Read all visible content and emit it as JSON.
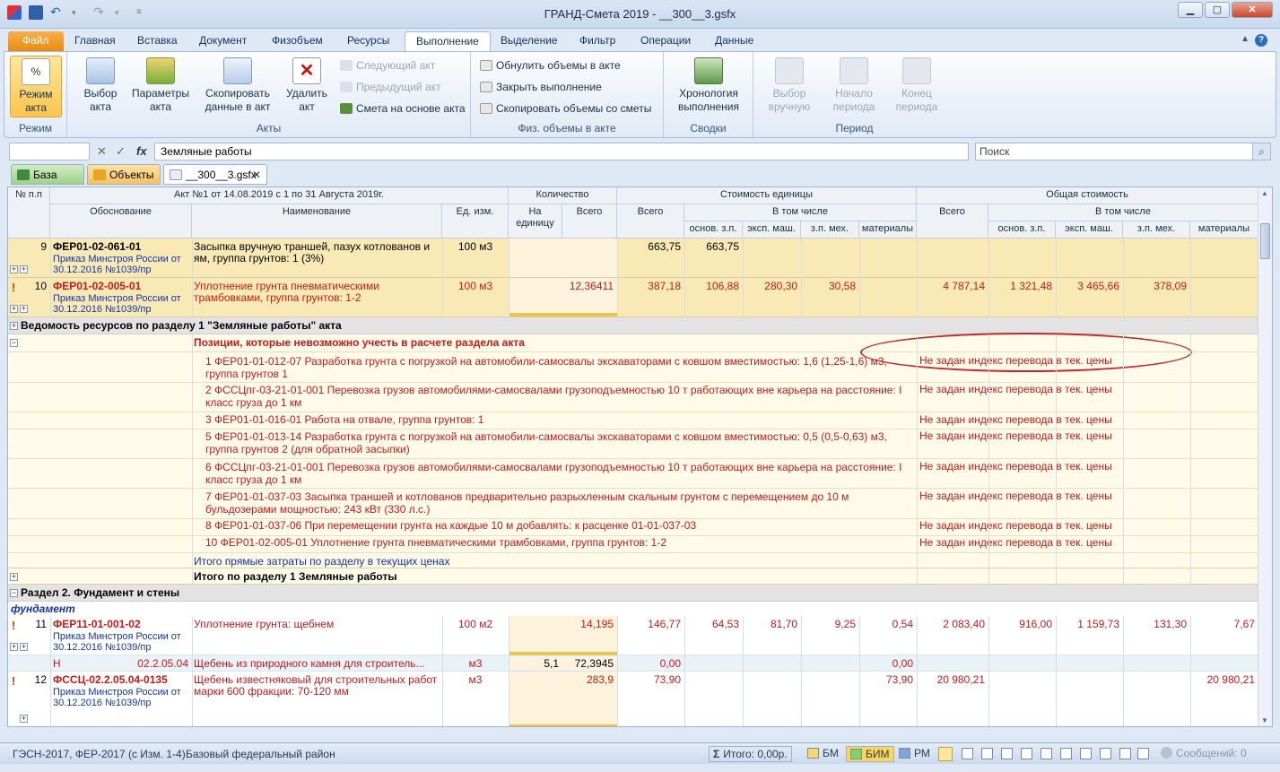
{
  "window": {
    "title": "ГРАНД-Смета 2019 - __300__3.gsfx"
  },
  "tabs": [
    "Файл",
    "Главная",
    "Вставка",
    "Документ",
    "Физобъем",
    "Ресурсы",
    "Выполнение",
    "Выделение",
    "Фильтр",
    "Операции",
    "Данные"
  ],
  "ribbon": {
    "mode_btn": "Режим акта",
    "mode_group": "Режим",
    "select_act": "Выбор акта",
    "act_params": "Параметры акта",
    "copy_data": "Скопировать данные в акт",
    "delete_act": "Удалить акт",
    "next_act": "Следующий акт",
    "prev_act": "Предыдущий акт",
    "estimate_based": "Смета на основе акта",
    "acts_group": "Акты",
    "reset_volumes": "Обнулить объемы в акте",
    "close_exec": "Закрыть выполнение",
    "copy_volumes": "Скопировать объемы со сметы",
    "phys_group": "Физ. объемы в акте",
    "chronology": "Хронология выполнения",
    "summaries_group": "Сводки",
    "manual_select": "Выбор вручную",
    "period_start": "Начало периода",
    "period_end": "Конец периода",
    "period_group": "Период"
  },
  "formula": {
    "value": "Земляные работы",
    "fx": "fx"
  },
  "search": {
    "placeholder": "Поиск"
  },
  "doctabs": {
    "base": "База",
    "objects": "Объекты",
    "file": "__300__3.gsfx"
  },
  "header": {
    "num": "№ п.п",
    "act_title": "Акт №1 от 14.08.2019 с 1 по 31 Августа 2019г.",
    "basis": "Обоснование",
    "name": "Наименование",
    "unit": "Ед. изм.",
    "qty": "Количество",
    "per_unit": "На единицу",
    "total": "Всего",
    "unit_cost": "Стоимость единицы",
    "uc_total": "Всего",
    "incl": "В том числе",
    "osn_zp": "основ. з.п.",
    "eksp_mash": "эксп. маш.",
    "zp_meh": "з.п. мех.",
    "materials": "материалы",
    "total_cost": "Общая стоимость",
    "tc_total": "Всего",
    "incl2": "В том числе",
    "osn_zp2": "основ. з.п.",
    "eksp_mash2": "эксп. маш.",
    "zp_meh2": "з.п. мех.",
    "materials2": "материалы"
  },
  "rows": {
    "r9": {
      "num": "9",
      "code": "ФЕР01-02-061-01",
      "order": "Приказ Минстроя России от 30.12.2016 №1039/пр",
      "name": "Засыпка вручную траншей, пазух котлованов и ям, группа грунтов: 1 (3%)",
      "unit": "100 м3",
      "uc_total": "663,75",
      "osn_zp": "663,75"
    },
    "r10": {
      "num": "10",
      "code": "ФЕР01-02-005-01",
      "order": "Приказ Минстроя России от 30.12.2016 №1039/пр",
      "name": "Уплотнение грунта пневматическими трамбовками, группа грунтов: 1-2",
      "unit": "100 м3",
      "qty_total": "12,36411",
      "uc_total": "387,18",
      "osn_zp": "106,88",
      "eksp": "280,30",
      "zpmeh": "30,58",
      "tc_total": "4 787,14",
      "tc_osn": "1 321,48",
      "tc_eksp": "3 465,66",
      "tc_zpmeh": "378,09"
    },
    "section_res": "Ведомость ресурсов по разделу 1 \"Земляные работы\" акта",
    "positions_title": "Позиции, которые невозможно учесть в расчете раздела акта",
    "positions": [
      {
        "text": "1 ФЕР01-01-012-07 Разработка грунта с погрузкой на автомобили-самосвалы экскаваторами с ковшом вместимостью: 1,6 (1,25-1,6) м3, группа грунтов 1",
        "note": "Не задан индекс перевода в тек. цены"
      },
      {
        "text": "2 ФССЦпг-03-21-01-001 Перевозка грузов автомобилями-самосвалами грузоподъемностью 10 т работающих вне карьера на расстояние: I класс груза до 1 км",
        "note": "Не задан индекс перевода в тек. цены"
      },
      {
        "text": "3 ФЕР01-01-016-01 Работа на отвале, группа грунтов: 1",
        "note": "Не задан индекс перевода в тек. цены"
      },
      {
        "text": "5 ФЕР01-01-013-14 Разработка грунта с погрузкой на автомобили-самосвалы экскаваторами с ковшом вместимостью: 0,5 (0,5-0,63) м3, группа грунтов 2 (для обратной засыпки)",
        "note": "Не задан индекс перевода в тек. цены"
      },
      {
        "text": "6 ФССЦпг-03-21-01-001 Перевозка грузов автомобилями-самосвалами грузоподъемностью 10 т работающих вне карьера на расстояние: I класс груза до 1 км",
        "note": "Не задан индекс перевода в тек. цены"
      },
      {
        "text": "7 ФЕР01-01-037-03 Засыпка траншей и котлованов предварительно разрыхленным скальным грунтом с перемещением до 10 м бульдозерами мощностью: 243 кВт (330 л.с.)",
        "note": "Не задан индекс перевода в тек. цены"
      },
      {
        "text": "8 ФЕР01-01-037-06 При перемещении грунта на каждые 10 м добавлять: к расценке 01-01-037-03",
        "note": "Не задан индекс перевода в тек. цены"
      },
      {
        "text": "10 ФЕР01-02-005-01 Уплотнение грунта пневматическими трамбовками, группа грунтов: 1-2",
        "note": "Не задан индекс перевода в тек. цены"
      }
    ],
    "direct_costs": "Итого прямые затраты по разделу в текущих ценах",
    "total_section1": "Итого по разделу 1 Земляные работы",
    "section2": "Раздел 2. Фундамент и стены",
    "subsection": "фундамент",
    "r11": {
      "num": "11",
      "code": "ФЕР11-01-001-02",
      "order": "Приказ Минстроя России от 30.12.2016 №1039/пр",
      "name": "Уплотнение грунта: щебнем",
      "unit": "100 м2",
      "qty_total": "14,195",
      "uc_total": "146,77",
      "osn_zp": "64,53",
      "eksp": "81,70",
      "zpmeh": "9,25",
      "mat": "0,54",
      "tc_total": "2 083,40",
      "tc_osn": "916,00",
      "tc_eksp": "1 159,73",
      "tc_zpmeh": "131,30",
      "tc_mat": "7,67"
    },
    "r11res": {
      "flag": "Н",
      "code": "02.2.05.04",
      "name": "Щебень из природного камня для строитель...",
      "unit": "м3",
      "per_unit": "5,1",
      "qty_total": "72,3945",
      "uc_total": "0,00",
      "mat": "0,00"
    },
    "r12": {
      "num": "12",
      "code": "ФССЦ-02.2.05.04-0135",
      "order": "Приказ Минстроя России от 30.12.2016 №1039/пр",
      "name": "Щебень известняковый для строительных работ марки 600 фракции: 70-120 мм",
      "unit": "м3",
      "qty_total": "283,9",
      "uc_total": "73,90",
      "mat": "73,90",
      "tc_total": "20 980,21",
      "tc_mat": "20 980,21"
    }
  },
  "status": {
    "norms": "ГЭСН-2017, ФЕР-2017 (с Изм. 1-4)",
    "region": "Базовый федеральный район",
    "total": "Итого: 0,00р.",
    "bm": "БМ",
    "bim": "БИМ",
    "rm": "РМ",
    "messages": "Сообщений: 0"
  },
  "colors": {
    "accent": "#f9e9b5",
    "red": "#c31b1b",
    "blue": "#1433a8"
  }
}
